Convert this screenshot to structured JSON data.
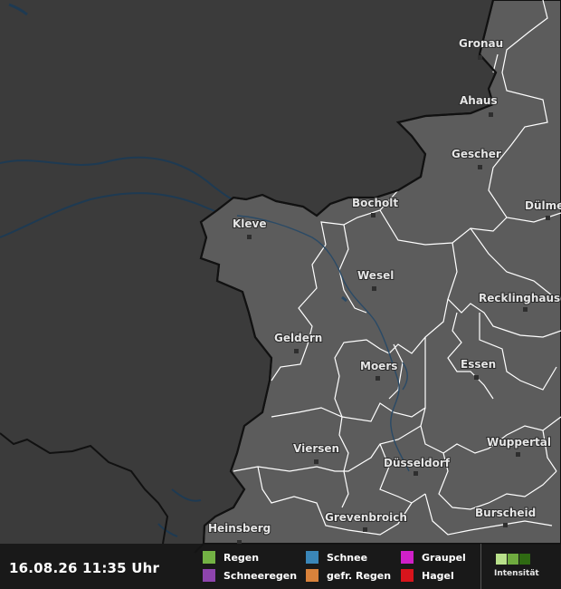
{
  "map": {
    "cities": [
      {
        "name": "Gronau"
      },
      {
        "name": "Ahaus"
      },
      {
        "name": "Gescher"
      },
      {
        "name": "Bocholt"
      },
      {
        "name": "Dülmen"
      },
      {
        "name": "Kleve"
      },
      {
        "name": "Wesel"
      },
      {
        "name": "Recklinghausen"
      },
      {
        "name": "Geldern"
      },
      {
        "name": "Moers"
      },
      {
        "name": "Essen"
      },
      {
        "name": "Viersen"
      },
      {
        "name": "Düsseldorf"
      },
      {
        "name": "Wuppertal"
      },
      {
        "name": "Grevenbroich"
      },
      {
        "name": "Burscheid"
      },
      {
        "name": "Heinsberg"
      }
    ],
    "colors": {
      "outside": "#3b3b3b",
      "land": "#5c5c5c",
      "border": "#111111",
      "district_line": "#ffffff",
      "water": "#1e3a52"
    }
  },
  "footer": {
    "timestamp": "16.08.26 11:35 Uhr",
    "legend": [
      {
        "label": "Regen",
        "color": "#73b244"
      },
      {
        "label": "Schneeregen",
        "color": "#8e44ad"
      },
      {
        "label": "Schnee",
        "color": "#3a86b8"
      },
      {
        "label": "gefr. Regen",
        "color": "#d9823b"
      },
      {
        "label": "Graupel",
        "color": "#d020c8"
      },
      {
        "label": "Hagel",
        "color": "#d8141c"
      }
    ],
    "intensity_label": "Intensität",
    "intensity_colors": [
      "#b8e08a",
      "#6fab3f",
      "#2f6a12"
    ]
  }
}
